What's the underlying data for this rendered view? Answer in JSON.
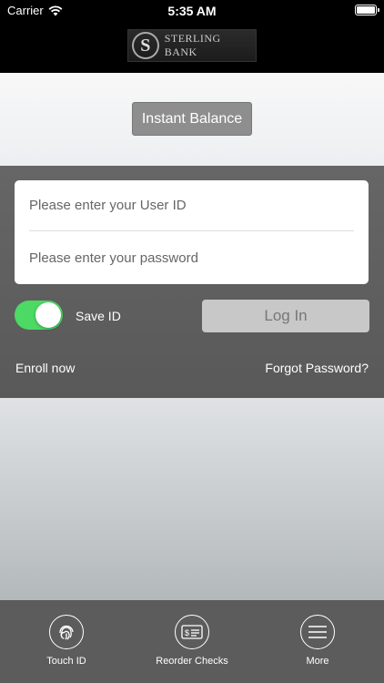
{
  "status_bar": {
    "carrier": "Carrier",
    "time": "5:35 AM"
  },
  "header": {
    "logo_letter": "S",
    "logo_text": "STERLING BANK"
  },
  "top": {
    "instant_balance_label": "Instant Balance"
  },
  "login": {
    "user_placeholder": "Please enter your User ID",
    "password_placeholder": "Please enter your password",
    "save_id_label": "Save ID",
    "save_id_enabled": true,
    "login_label": "Log In",
    "enroll_label": "Enroll now",
    "forgot_label": "Forgot Password?"
  },
  "tabs": [
    {
      "label": "Touch ID",
      "icon": "fingerprint-icon"
    },
    {
      "label": "Reorder Checks",
      "icon": "check-icon"
    },
    {
      "label": "More",
      "icon": "menu-icon"
    }
  ],
  "colors": {
    "toggle_on": "#4cd964",
    "panel": "#5f5f5f",
    "tab_bar": "#5c5c5c"
  }
}
